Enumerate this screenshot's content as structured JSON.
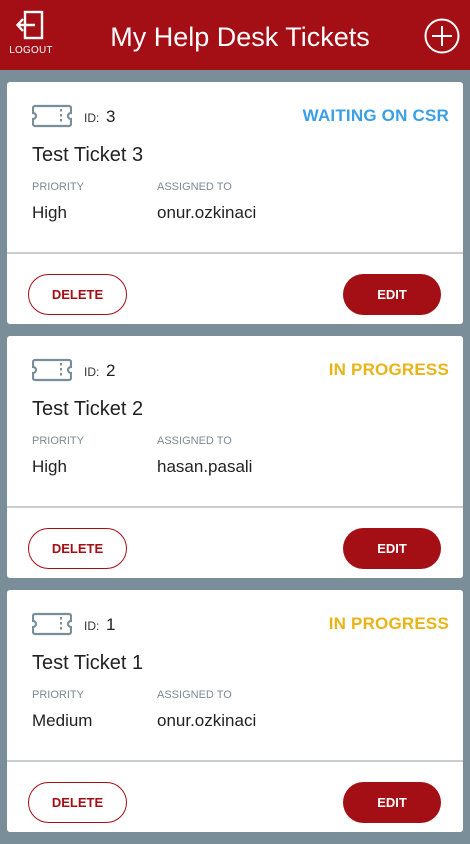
{
  "header": {
    "title": "My Help Desk Tickets",
    "logout_label": "LOGOUT",
    "logout_icon": "logout-icon",
    "add_icon": "plus-circle-icon"
  },
  "colors": {
    "brand": "#a30f15",
    "background": "#7a8e99",
    "status_waiting": "#3b9fe6",
    "status_in_progress": "#e8b417"
  },
  "labels": {
    "id": "ID:",
    "priority": "PRIORITY",
    "assigned_to": "ASSIGNED TO",
    "delete": "DELETE",
    "edit": "EDIT"
  },
  "tickets": [
    {
      "id": "3",
      "status": "WAITING ON CSR",
      "title": "Test Ticket 3",
      "priority": "High",
      "assigned_to": "onur.ozkinaci"
    },
    {
      "id": "2",
      "status": "IN PROGRESS",
      "title": "Test Ticket 2",
      "priority": "High",
      "assigned_to": "hasan.pasali"
    },
    {
      "id": "1",
      "status": "IN PROGRESS",
      "title": "Test Ticket 1",
      "priority": "Medium",
      "assigned_to": "onur.ozkinaci"
    }
  ]
}
